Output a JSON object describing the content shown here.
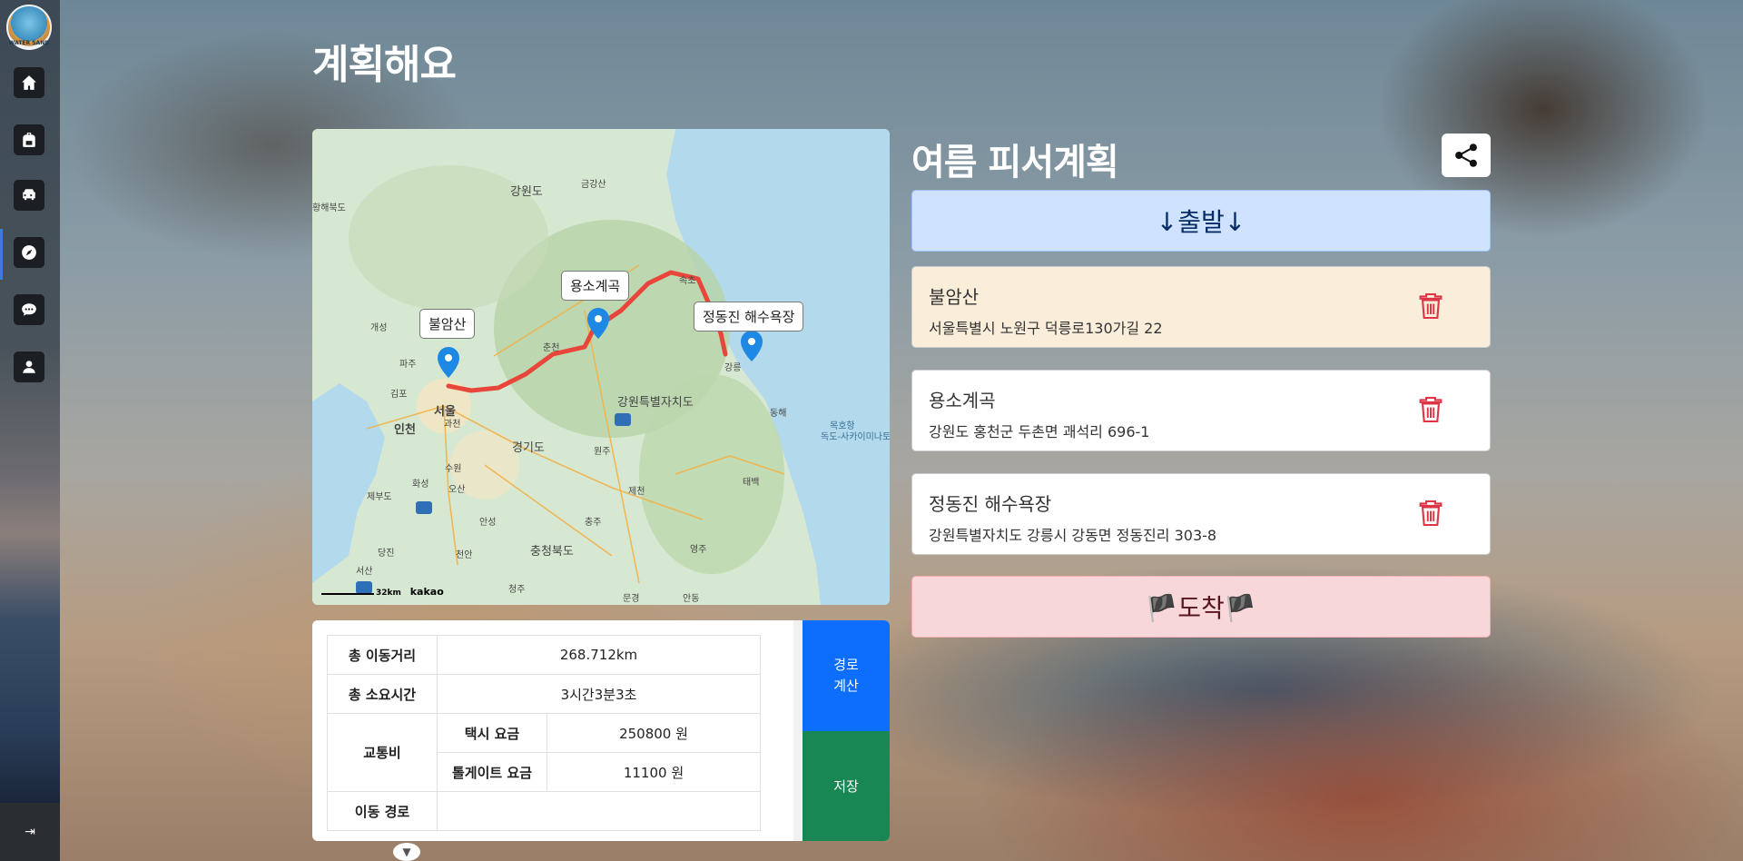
{
  "sidebar": {
    "logo_text": "WATER SAND",
    "items": [
      {
        "icon": "home-icon"
      },
      {
        "icon": "backpack-icon"
      },
      {
        "icon": "car-icon"
      },
      {
        "icon": "compass-icon"
      },
      {
        "icon": "chat-icon"
      },
      {
        "icon": "user-icon"
      }
    ],
    "collapse_label": "⇥"
  },
  "page": {
    "title": "계획해요"
  },
  "map": {
    "markers": [
      {
        "label": "불암산"
      },
      {
        "label": "용소계곡"
      },
      {
        "label": "정동진 해수욕장"
      }
    ],
    "region_labels": [
      "강원도",
      "금강산",
      "황해북도",
      "개성",
      "파주",
      "김포",
      "서울",
      "인천",
      "과천",
      "경기도",
      "수원",
      "오산",
      "화성",
      "제부도",
      "당진",
      "서산",
      "천안",
      "안성",
      "충주",
      "제천",
      "원주",
      "충청북도",
      "강원특별자치도",
      "춘천",
      "속초",
      "강릉",
      "동해",
      "태백",
      "영주",
      "청주",
      "안동",
      "문경",
      "독도-사카이미나토",
      "목호항"
    ],
    "scale_text": "32km",
    "brand": "kakao",
    "colors": {
      "route": "#e8463a",
      "marker": "#1e88e5"
    }
  },
  "summary": {
    "rows": [
      {
        "label": "총 이동거리",
        "value": "268.712km"
      },
      {
        "label": "총 소요시간",
        "value": "3시간3분3초"
      }
    ],
    "fare_label": "교통비",
    "taxi_label": "택시 요금",
    "taxi_value": "250800 원",
    "toll_label": "톨게이트 요금",
    "toll_value": "11100 원",
    "route_label": "이동 경로",
    "route_value": "",
    "calc_button": "경로 계산",
    "save_button": "저장"
  },
  "plan": {
    "title": "여름 피서계획",
    "start_label": "↓출발↓",
    "end_label": "🏴도착🏴",
    "places": [
      {
        "name": "불암산",
        "address": "서울특별시 노원구 덕릉로130가길 22"
      },
      {
        "name": "용소계곡",
        "address": "강원도 홍천군 두촌면 괘석리 696-1"
      },
      {
        "name": "정동진 해수욕장",
        "address": "강원특별자치도 강릉시 강동면 정동진리 303-8"
      }
    ]
  }
}
